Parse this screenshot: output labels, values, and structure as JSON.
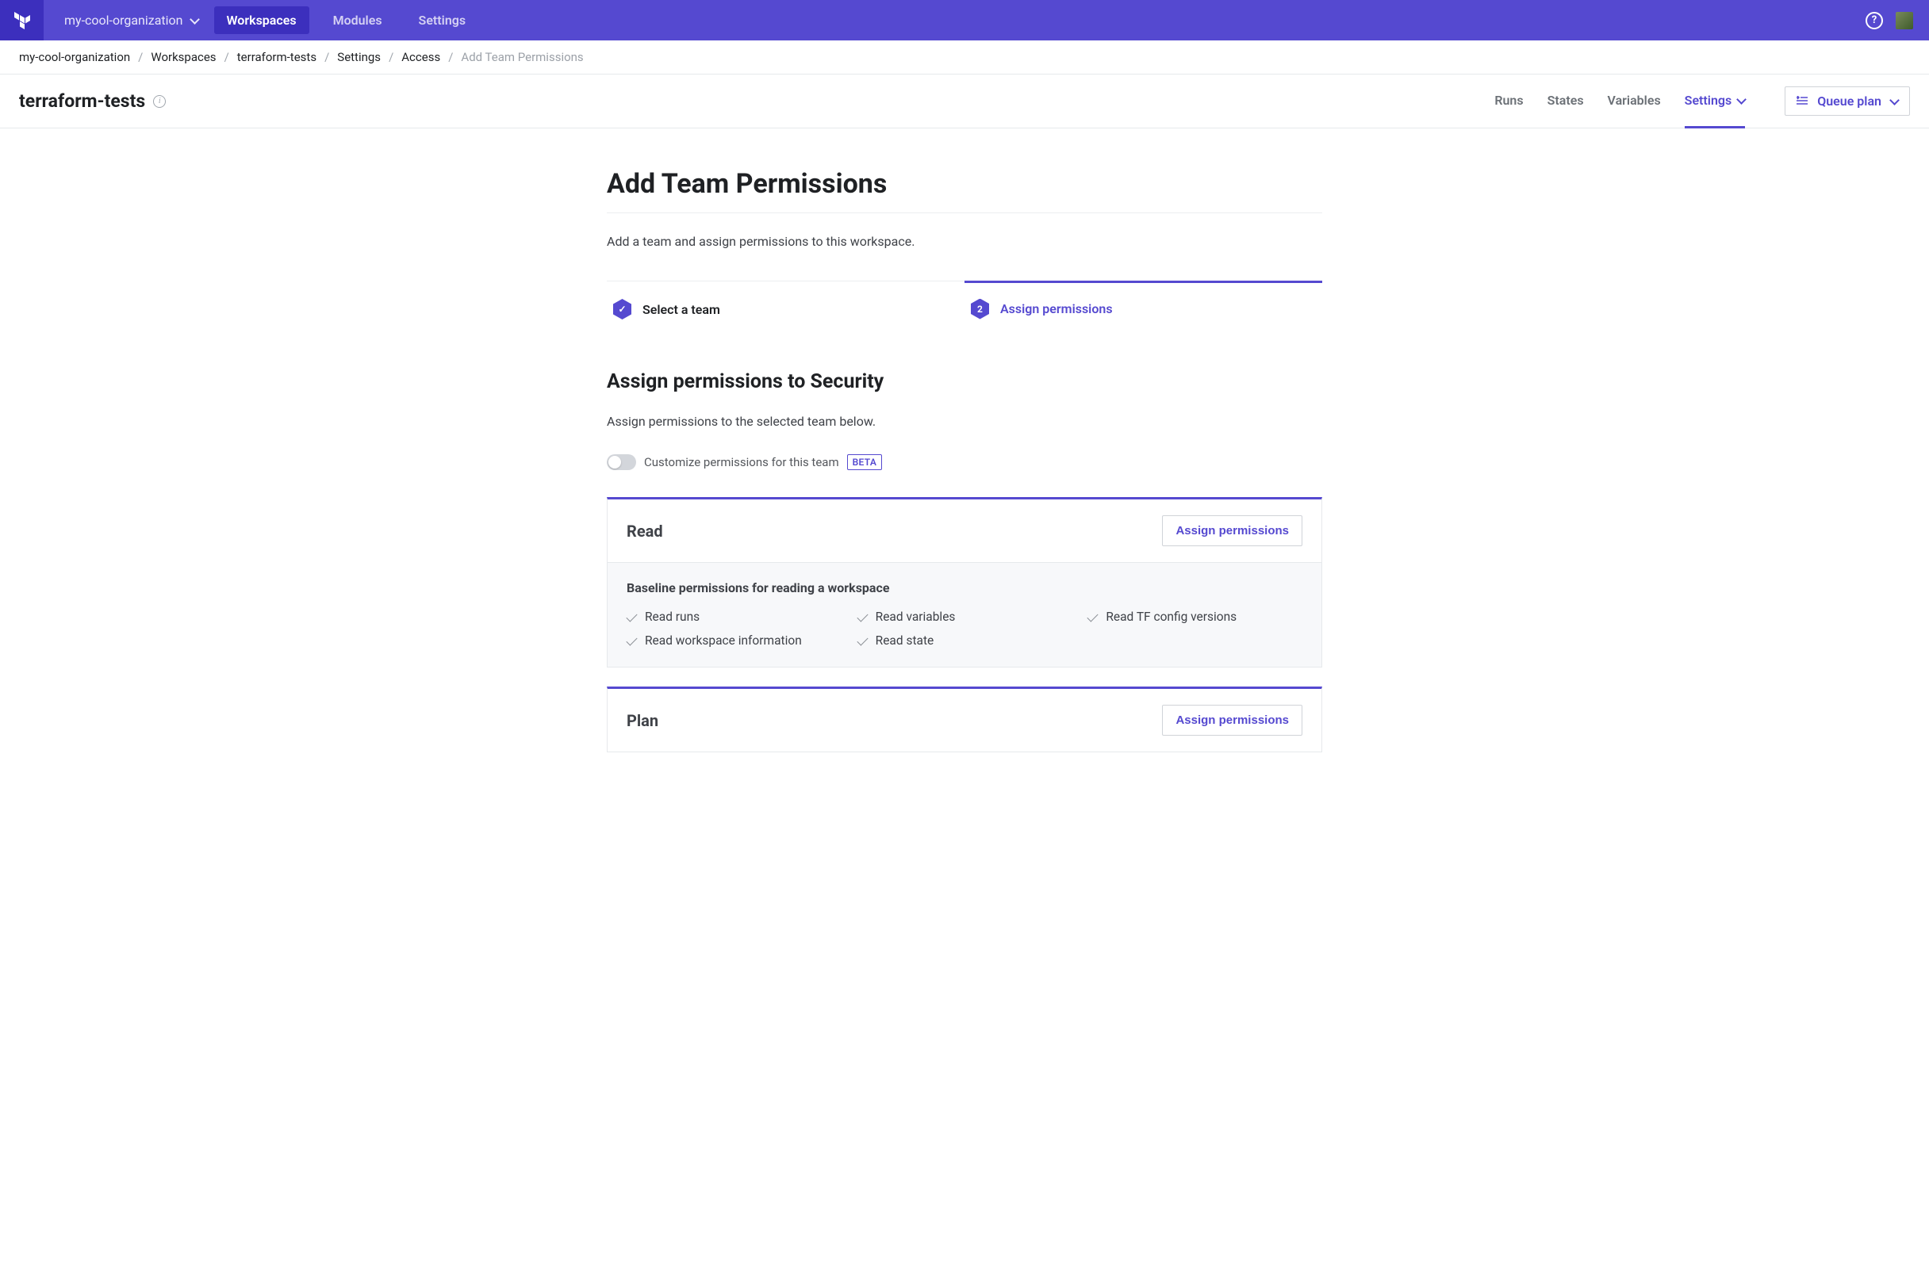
{
  "nav": {
    "org": "my-cool-organization",
    "items": [
      "Workspaces",
      "Modules",
      "Settings"
    ],
    "activeIndex": 0,
    "helpGlyph": "?"
  },
  "breadcrumb": {
    "items": [
      "my-cool-organization",
      "Workspaces",
      "terraform-tests",
      "Settings",
      "Access"
    ],
    "current": "Add Team Permissions"
  },
  "workspace": {
    "name": "terraform-tests",
    "tabs": [
      "Runs",
      "States",
      "Variables",
      "Settings"
    ],
    "activeTab": 3,
    "queueLabel": "Queue plan"
  },
  "page": {
    "title": "Add Team Permissions",
    "description": "Add a team and assign permissions to this workspace."
  },
  "stepper": {
    "steps": [
      {
        "label": "Select a team",
        "badge": "✓"
      },
      {
        "label": "Assign permissions",
        "badge": "2"
      }
    ],
    "activeIndex": 1
  },
  "section": {
    "title": "Assign permissions to Security",
    "description": "Assign permissions to the selected team below.",
    "toggleLabel": "Customize permissions for this team",
    "betaLabel": "BETA"
  },
  "cards": [
    {
      "name": "Read",
      "assignLabel": "Assign permissions",
      "baseline": "Baseline permissions for reading a workspace",
      "perms": [
        "Read runs",
        "Read variables",
        "Read TF config versions",
        "Read workspace information",
        "Read state"
      ]
    },
    {
      "name": "Plan",
      "assignLabel": "Assign permissions",
      "baseline": "",
      "perms": []
    }
  ]
}
